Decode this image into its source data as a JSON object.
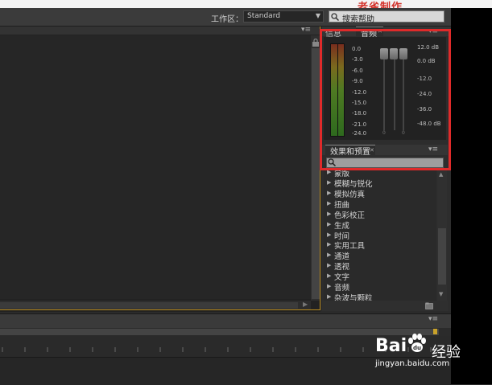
{
  "watermark_top": "老雀制作",
  "toolbar": {
    "workspace_label": "工作区：",
    "workspace_value": "Standard",
    "help_search": "搜索帮助"
  },
  "audio_panel": {
    "tabs": [
      {
        "label": "信息",
        "active": false
      },
      {
        "label": "音频",
        "active": true
      }
    ],
    "db_left": [
      "0.0",
      "-3.0",
      "-6.0",
      "-9.0",
      "-12.0",
      "-15.0",
      "-18.0",
      "-21.0",
      "-24.0"
    ],
    "db_right": [
      "12.0 dB",
      "0.0 dB",
      "-12.0",
      "-24.0",
      "-36.0",
      "-48.0 dB"
    ],
    "slider_zero": "0"
  },
  "effects_panel": {
    "tab_label": "效果和预置",
    "items": [
      "蒙版",
      "模糊与锐化",
      "模拟仿真",
      "扭曲",
      "色彩校正",
      "生成",
      "时间",
      "实用工具",
      "通道",
      "透视",
      "文字",
      "音频",
      "杂波与颗粒"
    ]
  },
  "watermark_bottom": {
    "baidu": "Bai",
    "jingyan": "经验",
    "url": "jingyan.baidu.com"
  },
  "colors": {
    "highlight": "#e02a2a",
    "panel_border_active": "#b88a1e"
  }
}
